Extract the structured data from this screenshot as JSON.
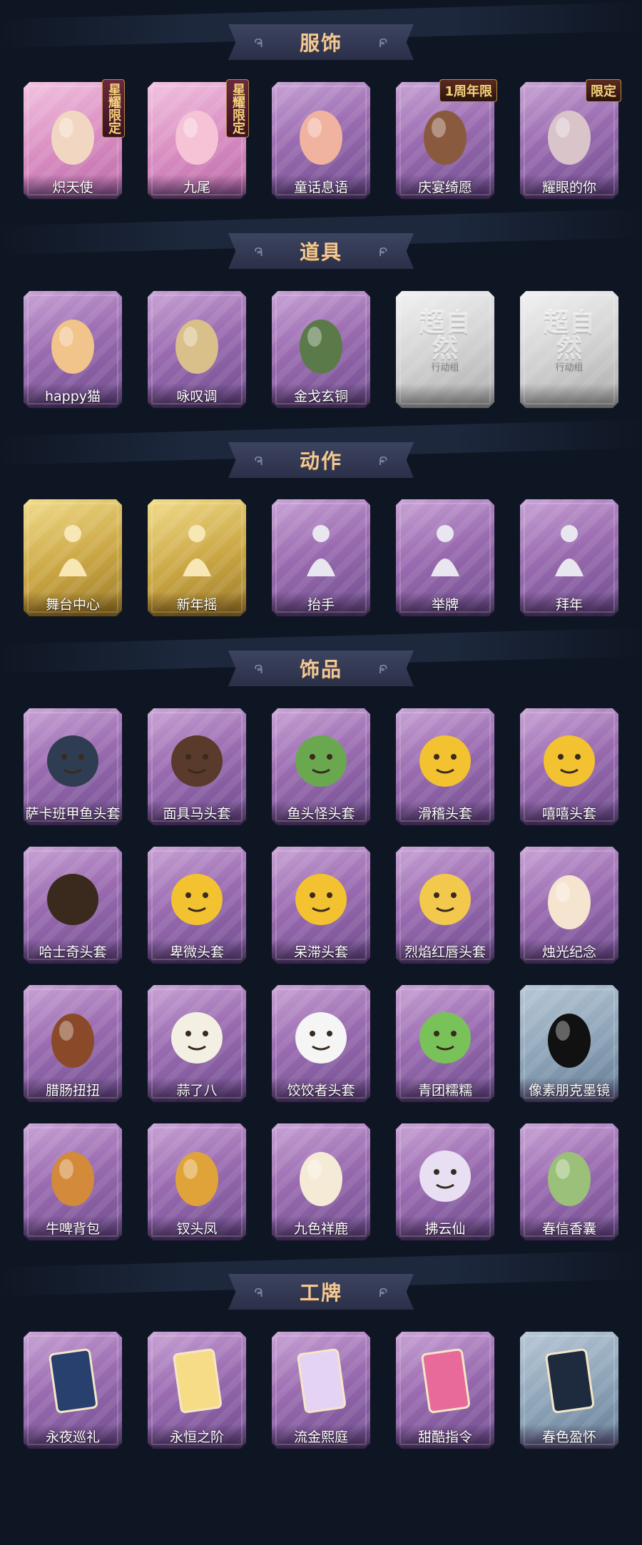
{
  "sections": [
    {
      "title": "服饰",
      "items": [
        {
          "label": "炽天使",
          "badge": "星耀限定",
          "icon": "angel-costume-icon",
          "tone": "pink"
        },
        {
          "label": "九尾",
          "badge": "星耀限定",
          "icon": "fox-costume-icon",
          "tone": "pink"
        },
        {
          "label": "童话息语",
          "badge": "",
          "icon": "fairy-costume-icon",
          "tone": "purple"
        },
        {
          "label": "庆宴绮愿",
          "badge": "1周年限",
          "icon": "cake-costume-icon",
          "tone": "purple"
        },
        {
          "label": "耀眼的你",
          "badge": "限定",
          "icon": "cowgirl-costume-icon",
          "tone": "purple"
        }
      ]
    },
    {
      "title": "道具",
      "items": [
        {
          "label": "happy猫",
          "badge": "",
          "icon": "cat-figure-icon",
          "tone": "purple"
        },
        {
          "label": "咏叹调",
          "badge": "",
          "icon": "flower-arch-icon",
          "tone": "purple"
        },
        {
          "label": "金戈玄铜",
          "badge": "",
          "icon": "lantern-icon",
          "tone": "purple"
        },
        {
          "label": "",
          "badge": "",
          "icon": "placeholder-logo-icon",
          "tone": "grey",
          "watermark": "超自然",
          "watermark_sub": "行动组"
        },
        {
          "label": "",
          "badge": "",
          "icon": "placeholder-logo-icon",
          "tone": "grey",
          "watermark": "超自然",
          "watermark_sub": "行动组"
        }
      ]
    },
    {
      "title": "动作",
      "items": [
        {
          "label": "舞台中心",
          "badge": "",
          "icon": "pose-sparkle-icon",
          "tone": "gold"
        },
        {
          "label": "新年摇",
          "badge": "",
          "icon": "pose-wave-icon",
          "tone": "gold"
        },
        {
          "label": "抬手",
          "badge": "",
          "icon": "hand-raise-icon",
          "tone": "purple"
        },
        {
          "label": "举牌",
          "badge": "",
          "icon": "sign-hold-icon",
          "tone": "purple"
        },
        {
          "label": "拜年",
          "badge": "",
          "icon": "bow-pose-icon",
          "tone": "purple"
        }
      ]
    },
    {
      "title": "饰品",
      "items": [
        {
          "label": "萨卡班甲鱼头套",
          "badge": "",
          "icon": "fish-mask-icon",
          "tone": "purple"
        },
        {
          "label": "面具马头套",
          "badge": "",
          "icon": "horse-mask-icon",
          "tone": "purple"
        },
        {
          "label": "鱼头怪头套",
          "badge": "",
          "icon": "fishman-mask-icon",
          "tone": "purple"
        },
        {
          "label": "滑稽头套",
          "badge": "",
          "icon": "smirk-emoji-icon",
          "tone": "purple"
        },
        {
          "label": "嘻嘻头套",
          "badge": "",
          "icon": "grin-emoji-icon",
          "tone": "purple"
        },
        {
          "label": "哈士奇头套",
          "badge": "",
          "icon": "husky-mask-icon",
          "tone": "purple"
        },
        {
          "label": "卑微头套",
          "badge": "",
          "icon": "humble-emoji-icon",
          "tone": "purple"
        },
        {
          "label": "呆滞头套",
          "badge": "",
          "icon": "stare-emoji-icon",
          "tone": "purple"
        },
        {
          "label": "烈焰红唇头套",
          "badge": "",
          "icon": "pikachu-mask-icon",
          "tone": "purple"
        },
        {
          "label": "烛光纪念",
          "badge": "",
          "icon": "candle-icon",
          "tone": "purple"
        },
        {
          "label": "腊肠扭扭",
          "badge": "",
          "icon": "dachshund-icon",
          "tone": "purple"
        },
        {
          "label": "蒜了八",
          "badge": "",
          "icon": "garlic-icon",
          "tone": "purple"
        },
        {
          "label": "饺饺者头套",
          "badge": "",
          "icon": "cloud-mask-icon",
          "tone": "purple"
        },
        {
          "label": "青团糯糯",
          "badge": "",
          "icon": "green-dumpling-icon",
          "tone": "purple"
        },
        {
          "label": "像素朋克墨镜",
          "badge": "",
          "icon": "pixel-glasses-icon",
          "tone": "blue"
        },
        {
          "label": "牛啤背包",
          "badge": "",
          "icon": "beer-backpack-icon",
          "tone": "purple"
        },
        {
          "label": "钗头凤",
          "badge": "",
          "icon": "phoenix-crown-icon",
          "tone": "purple"
        },
        {
          "label": "九色祥鹿",
          "badge": "",
          "icon": "deer-pendant-icon",
          "tone": "purple"
        },
        {
          "label": "拂云仙",
          "badge": "",
          "icon": "cloud-immortal-pendant-icon",
          "tone": "purple"
        },
        {
          "label": "春信香囊",
          "badge": "",
          "icon": "sachet-icon",
          "tone": "purple"
        }
      ]
    },
    {
      "title": "工牌",
      "items": [
        {
          "label": "永夜巡礼",
          "badge": "",
          "icon": "night-card-icon",
          "tone": "purple"
        },
        {
          "label": "永恒之阶",
          "badge": "",
          "icon": "gold-wing-card-icon",
          "tone": "purple"
        },
        {
          "label": "流金熙庭",
          "badge": "",
          "icon": "palace-card-icon",
          "tone": "purple"
        },
        {
          "label": "甜酷指令",
          "badge": "",
          "icon": "monster-card-icon",
          "tone": "purple"
        },
        {
          "label": "春色盈怀",
          "badge": "",
          "icon": "silhouette-card-icon",
          "tone": "blue"
        }
      ]
    }
  ],
  "colors": {
    "page_bg": "#0f1623",
    "banner_title": "#f2c995",
    "card_purple": "#9a6bb0",
    "card_gold": "#c9a542",
    "card_grey": "#cfcfcf",
    "card_blue": "#8aa1b6"
  }
}
